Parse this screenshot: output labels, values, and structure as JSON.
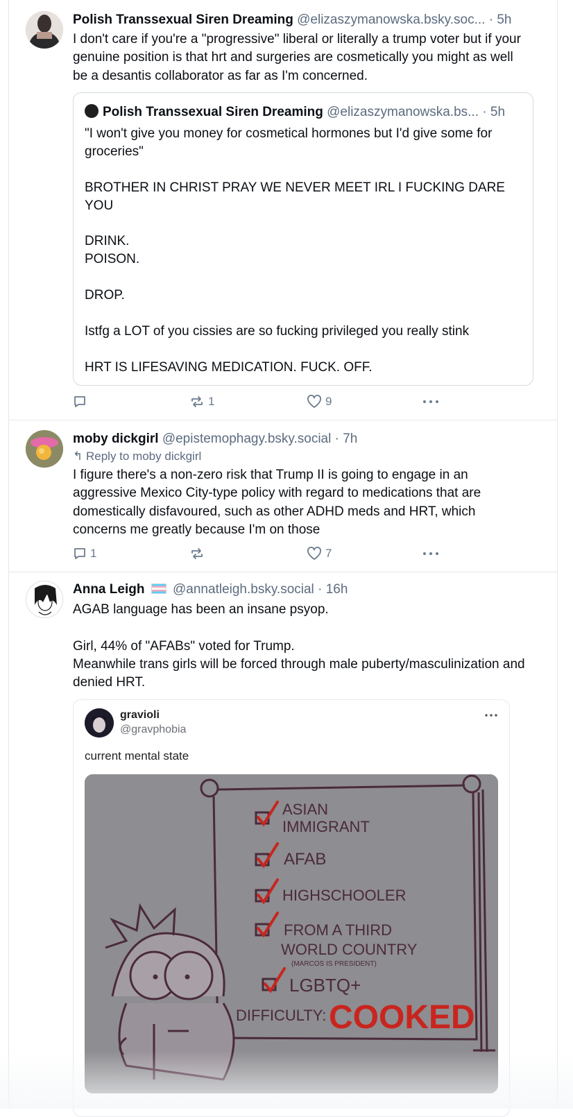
{
  "posts": [
    {
      "author_name": "Polish Transsexual Siren Dreaming",
      "handle": "@elizaszymanowska.bsky.soc...",
      "separator": "·",
      "time": "5h",
      "text": "I don't care if you're a \"progressive\" liberal or literally a trump voter but if your genuine position is that hrt and surgeries are cosmetically you might as well be a desantis collaborator as far as I'm concerned.",
      "quote": {
        "author_name": "Polish Transsexual Siren Dreaming",
        "handle": "@elizaszymanowska.bs...",
        "separator": "·",
        "time": "5h",
        "text": "\"I won't give you money for cosmetical hormones but I'd give some for groceries\"\n\nBROTHER IN CHRIST PRAY WE NEVER MEET IRL I FUCKING DARE YOU\n\nDRINK.\nPOISON.\n\nDROP.\n\nIstfg a LOT of you cissies are so fucking privileged you really stink\n\nHRT IS LIFESAVING MEDICATION. FUCK. OFF."
      },
      "reply_count": "",
      "repost_count": "1",
      "like_count": "9"
    },
    {
      "author_name": "moby dickgirl",
      "handle": "@epistemophagy.bsky.social",
      "separator": "·",
      "time": "7h",
      "reply_to": "Reply to moby dickgirl",
      "text": "I figure there's a non-zero risk that Trump II is going to engage in an aggressive Mexico City-type policy with regard to medications that are domestically disfavoured, such as other ADHD meds and HRT, which concerns me greatly because I'm on those",
      "reply_count": "1",
      "repost_count": "",
      "like_count": "7"
    },
    {
      "author_name": "Anna Leigh",
      "flag": "🏳️‍⚧️",
      "handle": "@annatleigh.bsky.social",
      "separator": "·",
      "time": "16h",
      "text": "AGAB language has been an insane psyop.\n\nGirl, 44% of \"AFABs\" voted for Trump.\nMeanwhile trans girls will be forced through male puberty/masculinization and denied HRT.",
      "embed": {
        "name": "gravioli",
        "handle": "@gravphobia",
        "caption": "current mental state",
        "comic": {
          "items": [
            "ASIAN",
            "IMMIGRANT",
            "AFAB",
            "HIGHSCHOOLER",
            "FROM A THIRD",
            "WORLD COUNTRY",
            "(MARCOS IS PRESIDENT)",
            "LGBTQ+"
          ],
          "difficulty_label": "DIFFICULTY:",
          "difficulty_value": "COOKED"
        }
      }
    }
  ],
  "colors": {
    "text": "#0b0f14",
    "muted": "#5b6b7e",
    "border": "#e3e7ec",
    "comic_ink": "#4a2a3c",
    "comic_red": "#c8251e"
  }
}
